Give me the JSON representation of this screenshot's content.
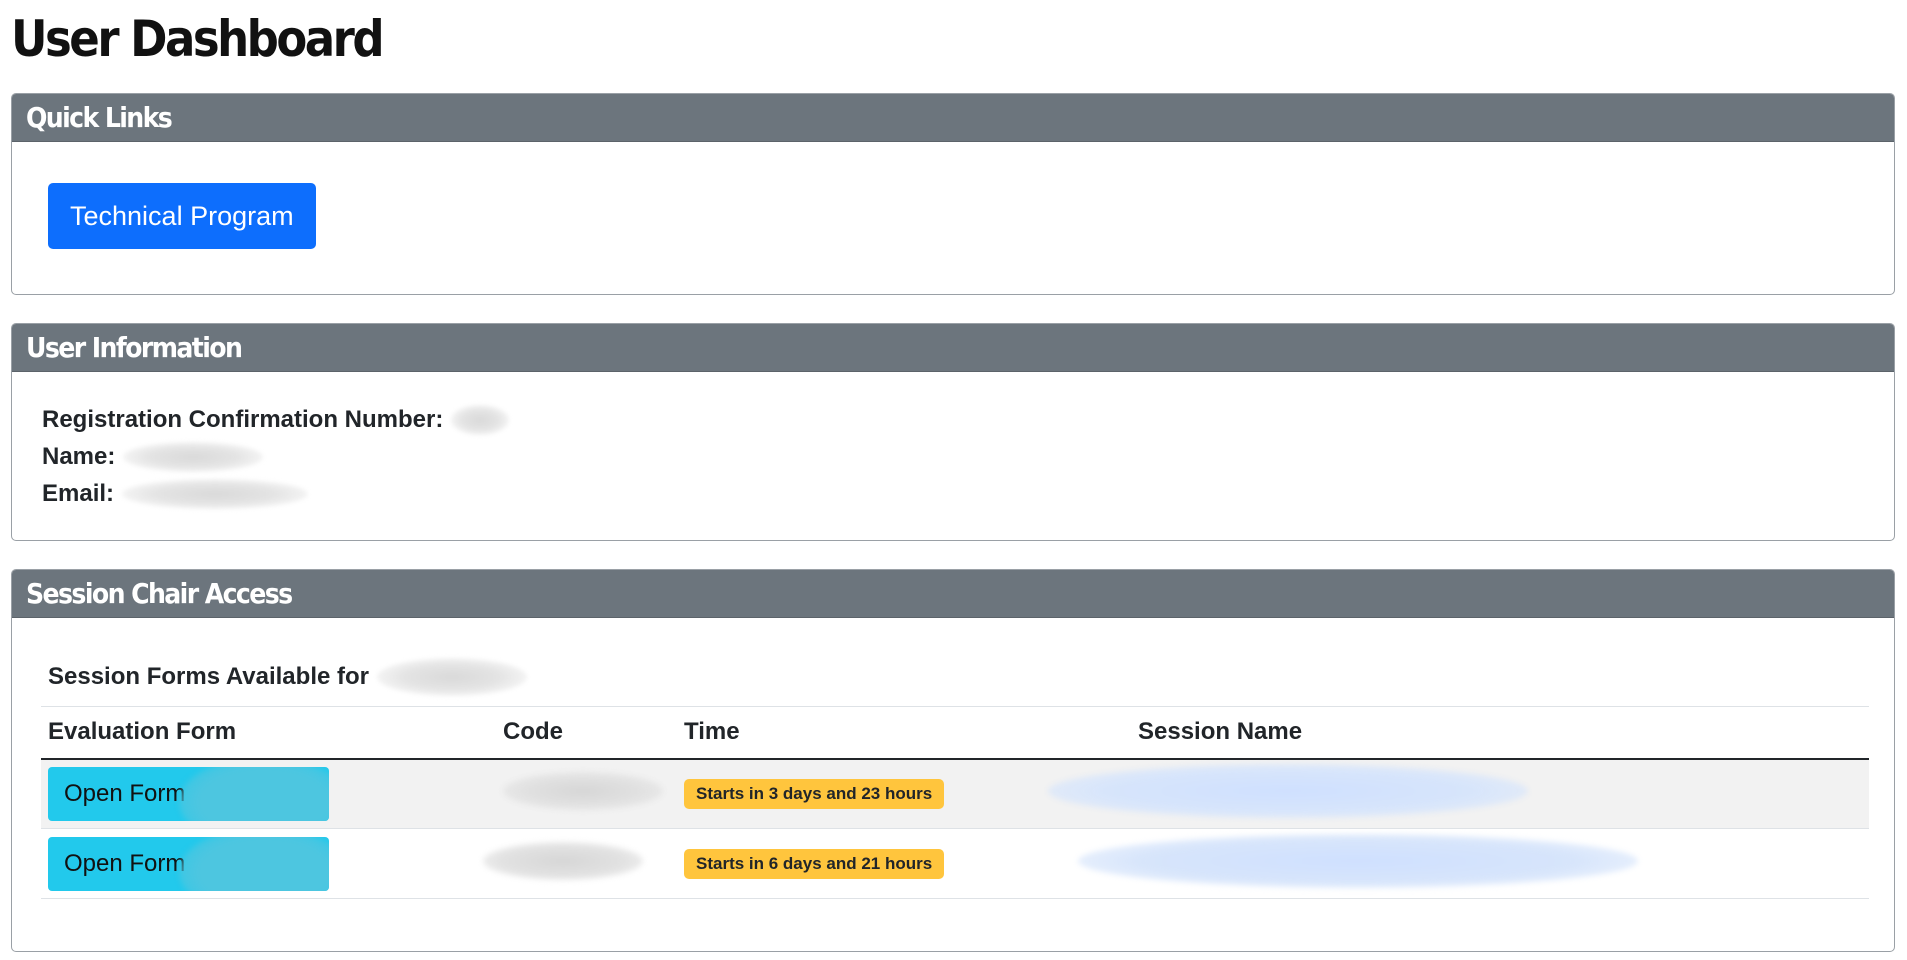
{
  "page": {
    "title": "User Dashboard"
  },
  "quick_links": {
    "header": "Quick Links",
    "technical_program_label": "Technical Program"
  },
  "user_info": {
    "header": "User Information",
    "confirmation_label": "Registration Confirmation Number:",
    "name_label": "Name:",
    "email_label": "Email:"
  },
  "session_chair": {
    "header": "Session Chair Access",
    "subheading": "Session Forms Available for",
    "columns": [
      "Evaluation Form",
      "Code",
      "Time",
      "Session Name"
    ],
    "rows": [
      {
        "button_label": "Open Form",
        "time": "Starts in 3 days and 23 hours"
      },
      {
        "button_label": "Open Form",
        "time": "Starts in 6 days and 21 hours"
      }
    ]
  },
  "colors": {
    "card_header": "#6c757d",
    "primary": "#0d6efd",
    "info": "#22c9ec",
    "warning": "#ffc53d"
  }
}
